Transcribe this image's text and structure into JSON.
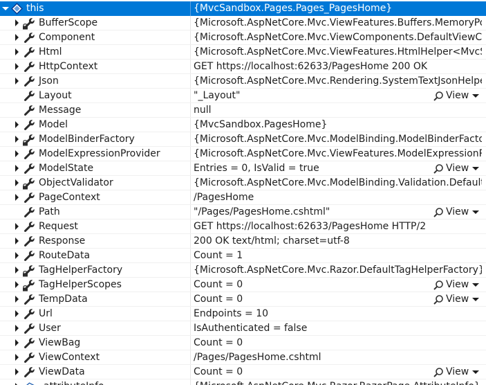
{
  "rows": [
    {
      "name": "this",
      "value": "{MvcSandbox.Pages.Pages_PagesHome}",
      "expander": "open",
      "icon": "class-icon",
      "lock": false,
      "selected": true,
      "view": false
    },
    {
      "name": "BufferScope",
      "value": "{Microsoft.AspNetCore.Mvc.ViewFeatures.Buffers.MemoryPool…",
      "expander": "closed",
      "icon": "wrench-icon",
      "lock": true,
      "view": false
    },
    {
      "name": "Component",
      "value": "{Microsoft.AspNetCore.Mvc.ViewComponents.DefaultViewCo…",
      "expander": "closed",
      "icon": "wrench-icon",
      "lock": false,
      "view": false
    },
    {
      "name": "Html",
      "value": "{Microsoft.AspNetCore.Mvc.ViewFeatures.HtmlHelper<MvcSa…",
      "expander": "closed",
      "icon": "wrench-icon",
      "lock": false,
      "view": false
    },
    {
      "name": "HttpContext",
      "value": "GET https://localhost:62633/PagesHome 200 OK",
      "expander": "closed",
      "icon": "wrench-icon",
      "lock": false,
      "view": false
    },
    {
      "name": "Json",
      "value": "{Microsoft.AspNetCore.Mvc.Rendering.SystemTextJsonHelper}",
      "expander": "closed",
      "icon": "wrench-icon",
      "lock": false,
      "view": false
    },
    {
      "name": "Layout",
      "value": "\"_Layout\"",
      "expander": "none",
      "icon": "wrench-icon",
      "lock": false,
      "view": true
    },
    {
      "name": "Message",
      "value": "null",
      "expander": "none",
      "icon": "wrench-icon",
      "lock": false,
      "view": false
    },
    {
      "name": "Model",
      "value": "{MvcSandbox.PagesHome}",
      "expander": "closed",
      "icon": "wrench-icon",
      "lock": false,
      "view": false
    },
    {
      "name": "ModelBinderFactory",
      "value": "{Microsoft.AspNetCore.Mvc.ModelBinding.ModelBinderFactor…",
      "expander": "closed",
      "icon": "wrench-icon",
      "lock": true,
      "view": false
    },
    {
      "name": "ModelExpressionProvider",
      "value": "{Microsoft.AspNetCore.Mvc.ViewFeatures.ModelExpressionPro…",
      "expander": "closed",
      "icon": "wrench-icon",
      "lock": false,
      "view": false
    },
    {
      "name": "ModelState",
      "value": "Entries = 0, IsValid = true",
      "expander": "closed",
      "icon": "wrench-icon",
      "lock": false,
      "view": true
    },
    {
      "name": "ObjectValidator",
      "value": "{Microsoft.AspNetCore.Mvc.ModelBinding.Validation.Default…",
      "expander": "closed",
      "icon": "wrench-icon",
      "lock": true,
      "view": false
    },
    {
      "name": "PageContext",
      "value": "/PagesHome",
      "expander": "closed",
      "icon": "wrench-icon",
      "lock": false,
      "view": false
    },
    {
      "name": "Path",
      "value": "\"/Pages/PagesHome.cshtml\"",
      "expander": "none",
      "icon": "wrench-icon",
      "lock": false,
      "view": true
    },
    {
      "name": "Request",
      "value": "GET https://localhost:62633/PagesHome HTTP/2",
      "expander": "closed",
      "icon": "wrench-icon",
      "lock": false,
      "view": false
    },
    {
      "name": "Response",
      "value": "200 OK text/html; charset=utf-8",
      "expander": "closed",
      "icon": "wrench-icon",
      "lock": false,
      "view": false
    },
    {
      "name": "RouteData",
      "value": "Count = 1",
      "expander": "closed",
      "icon": "wrench-icon",
      "lock": false,
      "view": false
    },
    {
      "name": "TagHelperFactory",
      "value": "{Microsoft.AspNetCore.Mvc.Razor.DefaultTagHelperFactory}",
      "expander": "closed",
      "icon": "wrench-icon",
      "lock": true,
      "view": false
    },
    {
      "name": "TagHelperScopes",
      "value": "Count = 0",
      "expander": "closed",
      "icon": "wrench-icon",
      "lock": true,
      "view": true
    },
    {
      "name": "TempData",
      "value": "Count = 0",
      "expander": "closed",
      "icon": "wrench-icon",
      "lock": false,
      "view": true
    },
    {
      "name": "Url",
      "value": "Endpoints = 10",
      "expander": "closed",
      "icon": "wrench-icon",
      "lock": false,
      "view": false
    },
    {
      "name": "User",
      "value": "IsAuthenticated = false",
      "expander": "closed",
      "icon": "wrench-icon",
      "lock": false,
      "view": false
    },
    {
      "name": "ViewBag",
      "value": "Count = 0",
      "expander": "closed",
      "icon": "wrench-icon",
      "lock": false,
      "view": false
    },
    {
      "name": "ViewContext",
      "value": "/Pages/PagesHome.cshtml",
      "expander": "closed",
      "icon": "wrench-icon",
      "lock": false,
      "view": false
    },
    {
      "name": "ViewData",
      "value": "Count = 0",
      "expander": "closed",
      "icon": "wrench-icon",
      "lock": false,
      "view": true
    },
    {
      "name": "_attributeInfo",
      "value": "{Microsoft.AspNetCore.Mvc.Razor.RazorPage.AttributeInfo}",
      "expander": "closed",
      "icon": "field-icon",
      "lock": false,
      "view": false
    }
  ],
  "view_label": "View",
  "colors": {
    "selection": "#0078d7",
    "wrench": "#2b2b2b",
    "class_icon": "#c8d8f0"
  }
}
